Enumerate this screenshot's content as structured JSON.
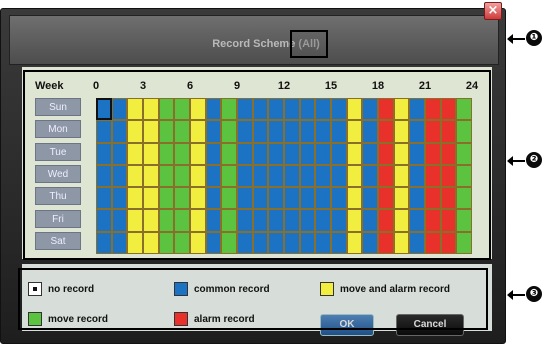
{
  "dialog": {
    "title_prefix": "Record Scheme",
    "title_suffix": "(All)",
    "close_label": "×"
  },
  "schedule": {
    "week_label": "Week",
    "hour_labels": [
      "0",
      "3",
      "6",
      "9",
      "12",
      "15",
      "18",
      "21",
      "24"
    ],
    "days": [
      "Sun",
      "Mon",
      "Tue",
      "Wed",
      "Thu",
      "Fri",
      "Sat"
    ],
    "hour_types": [
      "blue",
      "blue",
      "yellow",
      "yellow",
      "green",
      "green",
      "yellow",
      "blue",
      "green",
      "blue",
      "blue",
      "blue",
      "blue",
      "blue",
      "blue",
      "blue",
      "yellow",
      "blue",
      "red",
      "yellow",
      "blue",
      "red",
      "red",
      "green"
    ],
    "selected": {
      "day": 0,
      "hour": 0
    }
  },
  "legend": {
    "items": [
      {
        "key": "none",
        "label": "no record",
        "color": "#ffffff"
      },
      {
        "key": "common",
        "label": "common record",
        "color": "#1c73c4"
      },
      {
        "key": "move_alarm",
        "label": "move and alarm record",
        "color": "#f2ee3f"
      },
      {
        "key": "move",
        "label": "move record",
        "color": "#5cc341"
      },
      {
        "key": "alarm",
        "label": "alarm record",
        "color": "#e8312b"
      }
    ]
  },
  "buttons": {
    "ok": "OK",
    "cancel": "Cancel"
  },
  "callouts": [
    "❶",
    "❷",
    "❸"
  ],
  "colors": {
    "blue": "#1c73c4",
    "yellow": "#f2ee3f",
    "green": "#5cc341",
    "red": "#e8312b"
  }
}
